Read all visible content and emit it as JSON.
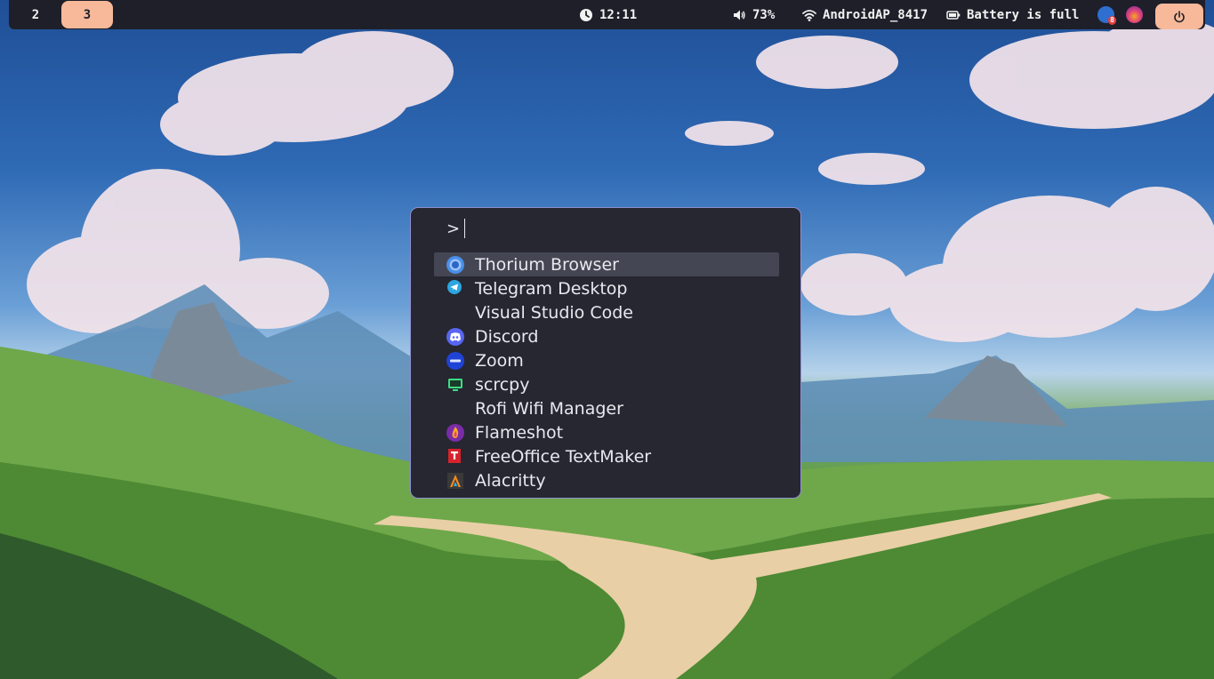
{
  "topbar": {
    "workspaces": [
      {
        "label": "2",
        "active": false
      },
      {
        "label": "3",
        "active": true
      }
    ],
    "clock": {
      "icon": "clock-icon",
      "time": "12:11"
    },
    "volume": {
      "icon": "speaker-icon",
      "value": "73%"
    },
    "wifi": {
      "icon": "wifi-icon",
      "ssid": "AndroidAP_8417"
    },
    "battery": {
      "icon": "battery-icon",
      "status": "Battery is full"
    },
    "tray": [
      {
        "name": "tray-app-icon",
        "badge": "8"
      },
      {
        "name": "flameshot-tray-icon"
      }
    ],
    "power": {
      "icon": "power-icon"
    }
  },
  "launcher": {
    "prompt": ">",
    "input_value": "",
    "entries": [
      {
        "label": "Thorium Browser",
        "icon": "thorium-browser-icon",
        "selected": true
      },
      {
        "label": "Telegram Desktop",
        "icon": "telegram-icon",
        "selected": false
      },
      {
        "label": "Visual Studio Code",
        "icon": "",
        "selected": false
      },
      {
        "label": "Discord",
        "icon": "discord-icon",
        "selected": false
      },
      {
        "label": "Zoom",
        "icon": "zoom-icon",
        "selected": false
      },
      {
        "label": "scrcpy",
        "icon": "scrcpy-icon",
        "selected": false
      },
      {
        "label": "Rofi Wifi Manager",
        "icon": "",
        "selected": false
      },
      {
        "label": "Flameshot",
        "icon": "flameshot-icon",
        "selected": false
      },
      {
        "label": "FreeOffice TextMaker",
        "icon": "textmaker-icon",
        "selected": false
      },
      {
        "label": "Alacritty",
        "icon": "alacritty-icon",
        "selected": false
      }
    ]
  },
  "colors": {
    "bar_bg": "#1e1f29",
    "accent": "#f7b99a",
    "launcher_bg": "#262731",
    "launcher_border": "#8e8ecf",
    "selection_bg": "#444653"
  }
}
